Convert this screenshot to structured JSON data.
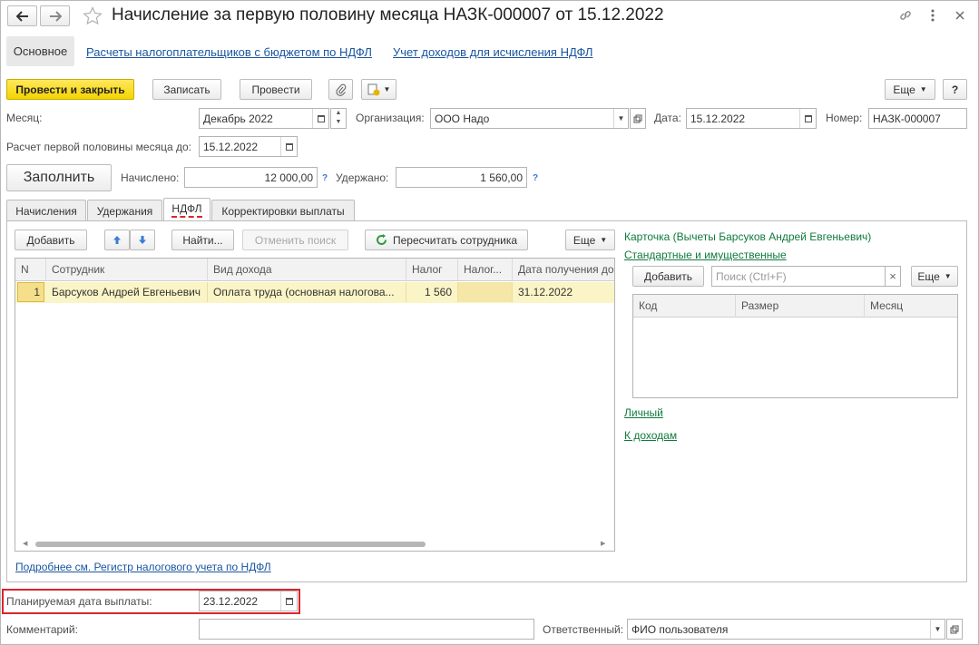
{
  "window": {
    "title": "Начисление за первую половину месяца НАЗК-000007 от 15.12.2022",
    "back_icon": "arrow-left-icon",
    "forward_icon": "arrow-right-icon",
    "favorite_icon": "star-icon",
    "link_icon": "link-icon",
    "more_icon": "more-vert-icon",
    "close_icon": "close-icon"
  },
  "nav": {
    "main": "Основное",
    "links": [
      "Расчеты налогоплательщиков с бюджетом по НДФЛ",
      "Учет доходов для исчисления НДФЛ"
    ]
  },
  "toolbar": {
    "post_close": "Провести и закрыть",
    "save": "Записать",
    "post": "Провести",
    "more": "Еще",
    "help": "?"
  },
  "header": {
    "month_label": "Месяц:",
    "month_value": "Декабрь 2022",
    "org_label": "Организация:",
    "org_value": "ООО Надо",
    "date_label": "Дата:",
    "date_value": "15.12.2022",
    "number_label": "Номер:",
    "number_value": "НАЗК-000007",
    "calc_label": "Расчет первой половины месяца до:",
    "calc_value": "15.12.2022",
    "fill_button": "Заполнить",
    "accrued_label": "Начислено:",
    "accrued_value": "12 000,00",
    "withheld_label": "Удержано:",
    "withheld_value": "1 560,00",
    "hint": "?"
  },
  "tabs": [
    "Начисления",
    "Удержания",
    "НДФЛ",
    "Корректировки выплаты"
  ],
  "active_tab": "НДФЛ",
  "ndfl": {
    "add": "Добавить",
    "find": "Найти...",
    "cancel_search": "Отменить поиск",
    "recalc": "Пересчитать сотрудника",
    "more": "Еще",
    "columns": [
      "N",
      "Сотрудник",
      "Вид дохода",
      "Налог",
      "Налог...",
      "Дата получения до..."
    ],
    "rows": [
      [
        "1",
        "Барсуков Андрей Евгеньевич",
        "Оплата труда (основная налогова...",
        "1 560",
        "",
        "31.12.2022"
      ]
    ],
    "footer_link": "Подробнее см. Регистр налогового учета по НДФЛ"
  },
  "card": {
    "title": "Карточка (Вычеты Барсуков Андрей Евгеньевич)",
    "standard_link": "Стандартные и имущественные",
    "add": "Добавить",
    "search_placeholder": "Поиск (Ctrl+F)",
    "clear": "×",
    "more": "Еще",
    "columns": [
      "Код",
      "Размер",
      "Месяц"
    ],
    "personal_link": "Личный",
    "income_link": "К доходам"
  },
  "footer": {
    "pay_date_label": "Планируемая дата выплаты:",
    "pay_date_value": "23.12.2022",
    "comment_label": "Комментарий:",
    "comment_value": "",
    "responsible_label": "Ответственный:",
    "responsible_value": "ФИО пользователя"
  },
  "colors": {
    "primary_button": "#f5d400",
    "link": "#1a55a0",
    "green_link": "#0f7a3b",
    "selected_row": "#fbf4c6",
    "highlight_border": "#d9262c"
  }
}
